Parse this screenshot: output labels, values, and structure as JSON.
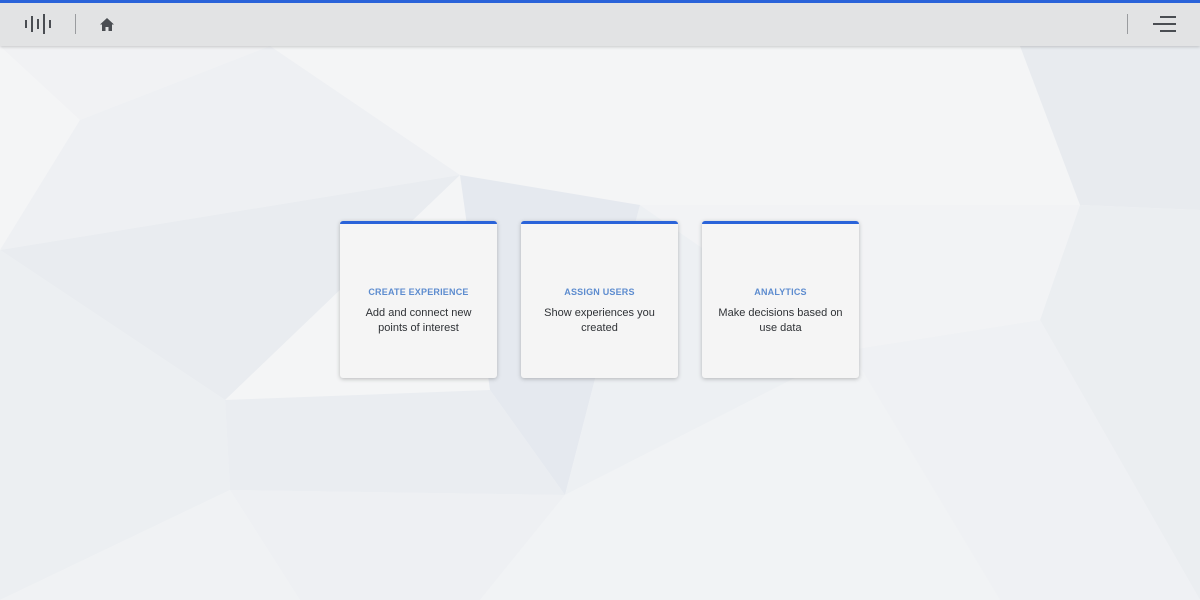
{
  "colors": {
    "accent": "#2a63d9",
    "card_title": "#5d8ccf",
    "topbar_bg": "#e2e3e4",
    "icon": "#4a4d52"
  },
  "header": {
    "logo_icon": "audio-bars-logo-icon",
    "home_icon": "home-icon",
    "menu_icon": "hamburger-menu-icon"
  },
  "cards": [
    {
      "title": "CREATE EXPERIENCE",
      "description": "Add and connect new points of interest"
    },
    {
      "title": "ASSIGN USERS",
      "description": "Show experiences you created"
    },
    {
      "title": "ANALYTICS",
      "description": "Make decisions based on use data"
    }
  ]
}
